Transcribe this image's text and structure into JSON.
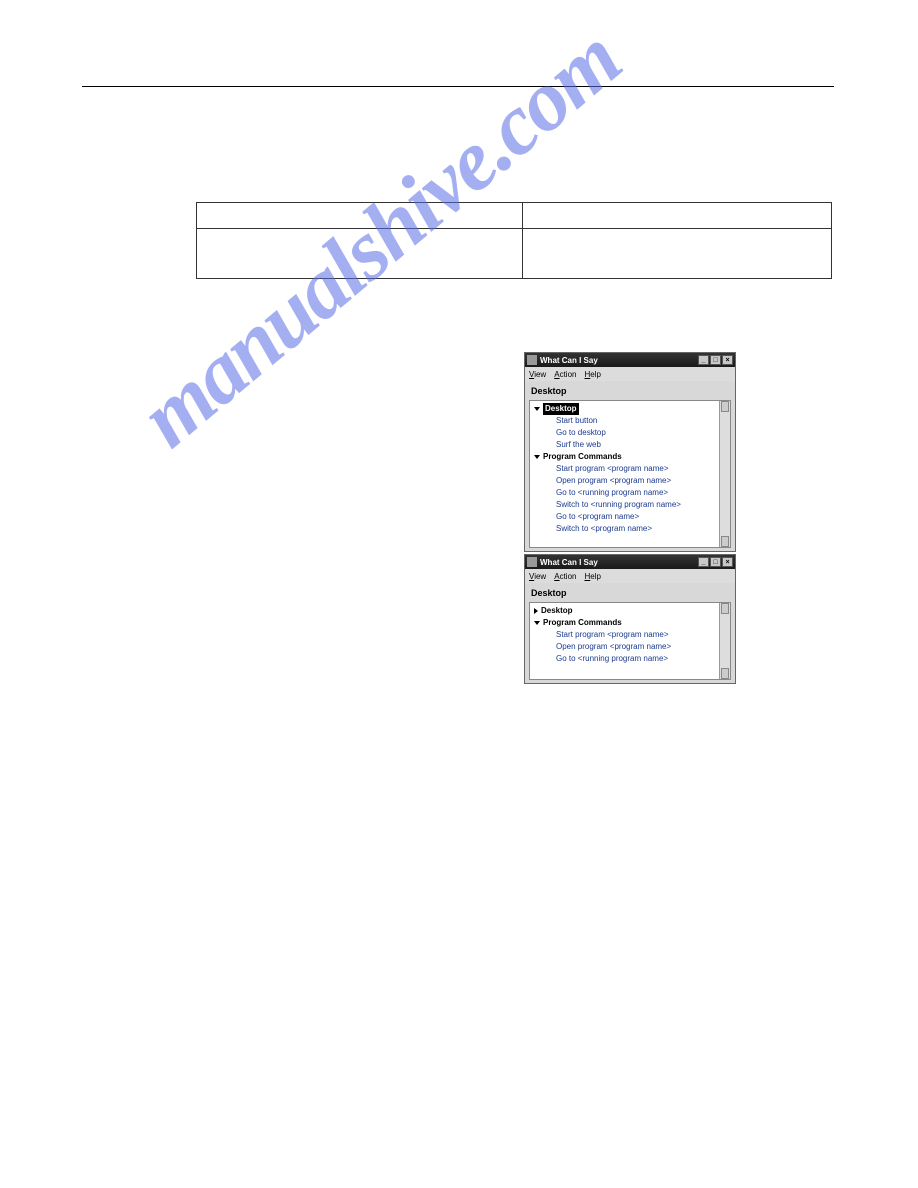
{
  "watermark": "manualshive.com",
  "window": {
    "title": "What Can I Say",
    "menu": {
      "view": "View",
      "action": "Action",
      "help": "Help"
    },
    "context_label": "Desktop",
    "win_buttons": {
      "min": "_",
      "max": "□",
      "close": "×"
    }
  },
  "win1_tree": {
    "group1": {
      "label": "Desktop",
      "items": [
        "Start button",
        "Go to desktop",
        "Surf the web"
      ]
    },
    "group2": {
      "label": "Program Commands",
      "items": [
        "Start program <program name>",
        "Open program <program name>",
        "Go to <running program name>",
        "Switch to <running program name>",
        "Go to <program name>",
        "Switch to <program name>"
      ]
    }
  },
  "win2_tree": {
    "group1": {
      "label": "Desktop"
    },
    "group2": {
      "label": "Program Commands",
      "items": [
        "Start program <program name>",
        "Open program <program name>",
        "Go to <running program name>"
      ]
    }
  }
}
